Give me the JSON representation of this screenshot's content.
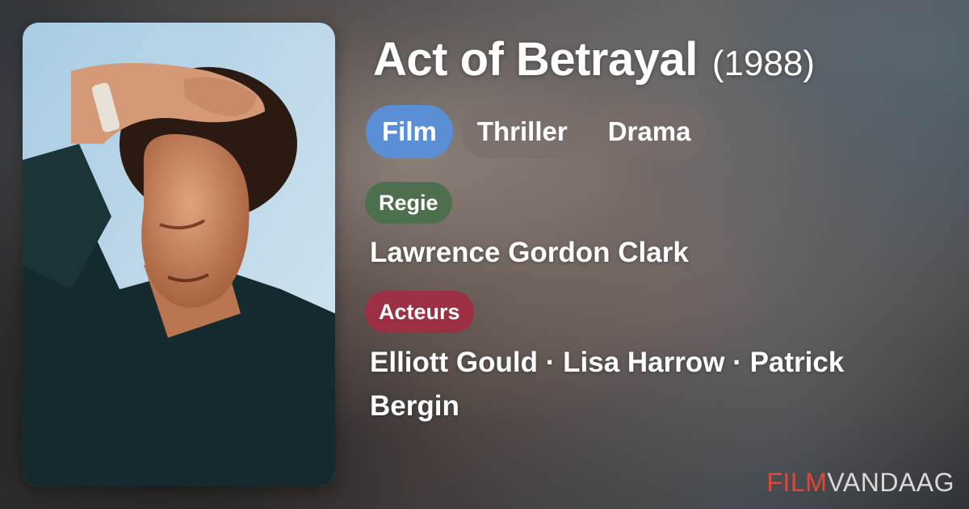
{
  "movie": {
    "title": "Act of Betrayal",
    "year": "(1988)"
  },
  "tags": [
    "Film",
    "Thriller",
    "Drama"
  ],
  "regie": {
    "label": "Regie",
    "name": "Lawrence Gordon Clark"
  },
  "acteurs": {
    "label": "Acteurs",
    "names": "Elliott Gould · Lisa Harrow · Patrick Bergin"
  },
  "brand": {
    "part1": "FILM",
    "part2": "VANDAAG"
  },
  "colors": {
    "tag_primary": "#5a8fd6",
    "regie_badge": "#4d6f4e",
    "acteurs_badge": "#9c2f41",
    "brand_red": "#e0483b"
  }
}
